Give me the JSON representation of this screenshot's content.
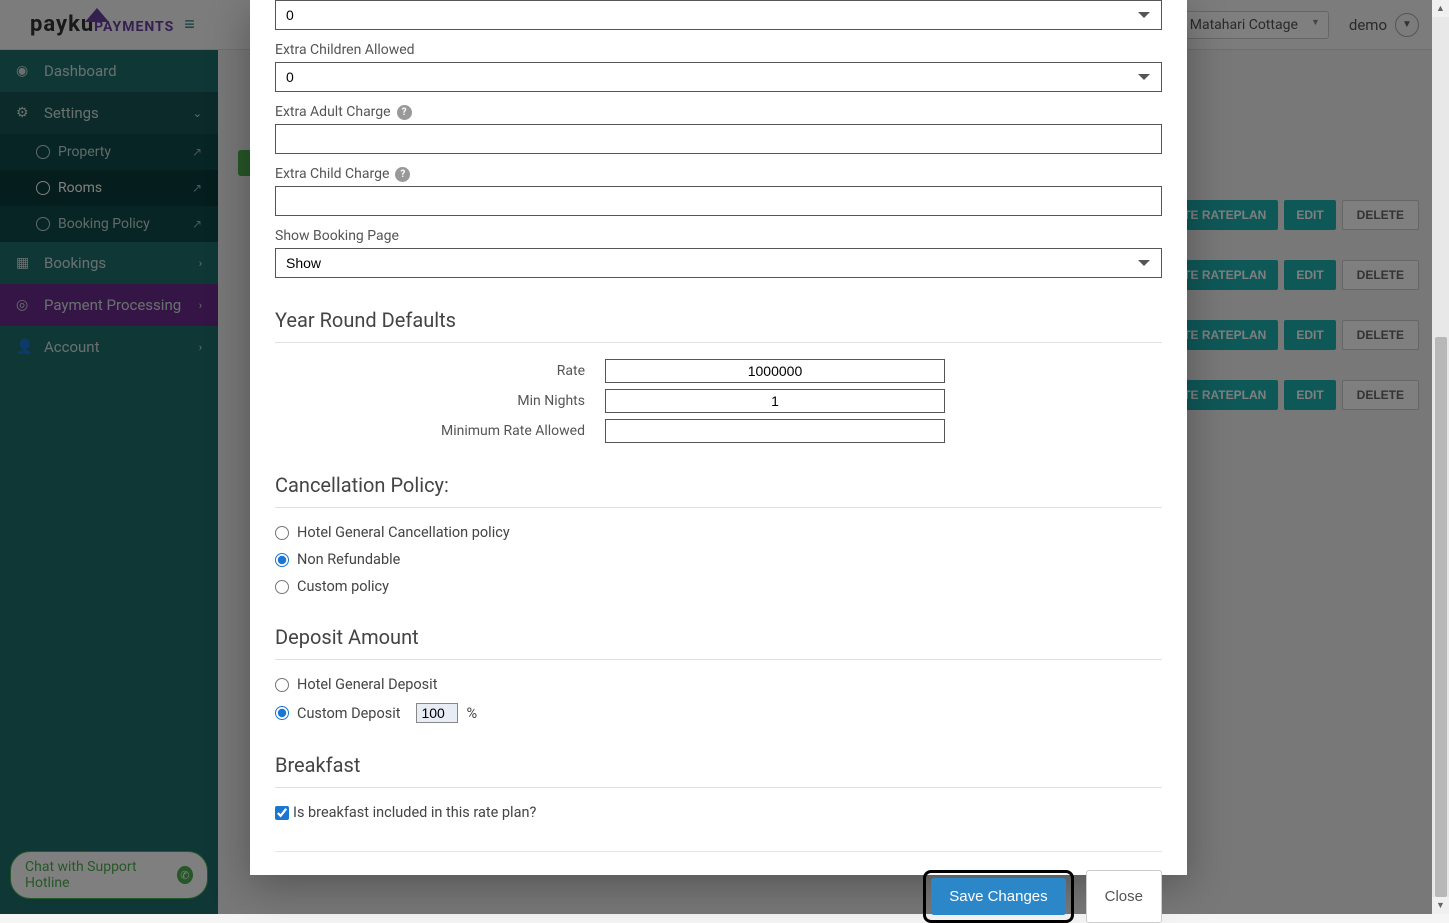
{
  "brand": {
    "main": "payku",
    "sub": "PAYMENTS"
  },
  "topbar": {
    "hotel": "Matahari Cottage",
    "user": "demo"
  },
  "sidebar": {
    "dashboard": "Dashboard",
    "settings": "Settings",
    "property": "Property",
    "rooms": "Rooms",
    "booking_policy": "Booking Policy",
    "bookings": "Bookings",
    "payment_processing": "Payment Processing",
    "account": "Account",
    "chat": "Chat with Support Hotline"
  },
  "room_actions": {
    "create_rateplan": "EATE RATEPLAN",
    "edit": "EDIT",
    "delete": "DELETE"
  },
  "modal": {
    "extra_adults_label": "",
    "extra_adults_value": "0",
    "extra_children_label": "Extra Children Allowed",
    "extra_children_value": "0",
    "extra_adult_charge_label": "Extra Adult Charge",
    "extra_adult_charge_value": "",
    "extra_child_charge_label": "Extra Child Charge",
    "extra_child_charge_value": "",
    "show_booking_label": "Show Booking Page",
    "show_booking_value": "Show",
    "year_round_heading": "Year Round Defaults",
    "rate_label": "Rate",
    "rate_value": "1000000",
    "min_nights_label": "Min Nights",
    "min_nights_value": "1",
    "min_rate_label": "Minimum Rate Allowed",
    "min_rate_value": "",
    "cancellation_heading": "Cancellation Policy:",
    "cancel_opt1": "Hotel General Cancellation policy",
    "cancel_opt2": "Non Refundable",
    "cancel_opt3": "Custom policy",
    "deposit_heading": "Deposit Amount",
    "deposit_opt1": "Hotel General Deposit",
    "deposit_opt2": "Custom Deposit",
    "deposit_value": "100",
    "deposit_pct": "%",
    "breakfast_heading": "Breakfast",
    "breakfast_check": "Is breakfast included in this rate plan?",
    "save_label": "Save Changes",
    "close_label": "Close"
  }
}
